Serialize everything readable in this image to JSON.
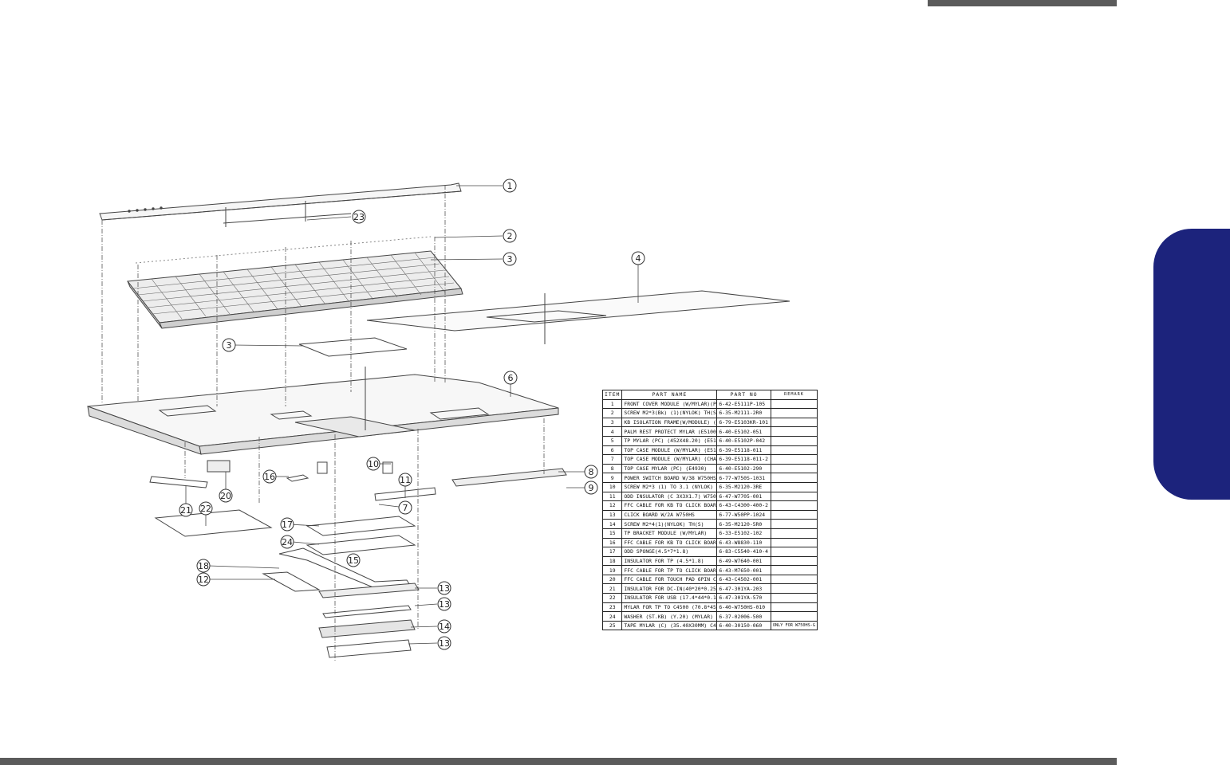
{
  "header": {
    "bar_color": "#5b5b5b"
  },
  "side_tab": {
    "color": "#1c237c"
  },
  "callouts": [
    "1",
    "23",
    "2",
    "3",
    "4",
    "3",
    "6",
    "16",
    "10",
    "8",
    "9",
    "11",
    "7",
    "21",
    "22",
    "20",
    "17",
    "24",
    "15",
    "18",
    "12",
    "13",
    "13",
    "14",
    "13"
  ],
  "parts_table": {
    "headers": {
      "item": "ITEM",
      "name": "PART    NAME",
      "no": "PART    NO",
      "remark": "REMARK"
    },
    "rows": [
      {
        "item": "1",
        "name": "FRONT COVER MODULE (W/MYLAR)(PW) (E4930)",
        "no": "6-42-E5111P-105",
        "remark": ""
      },
      {
        "item": "2",
        "name": "SCREW M2*3(Bk) (1)(NYLOK) TH(S)",
        "no": "6-35-M2111-2R0",
        "remark": ""
      },
      {
        "item": "3",
        "name": "KB ISOLATION FRAME(W/MODULE) (E5100)",
        "no": "6-79-E5103KR-101",
        "remark": ""
      },
      {
        "item": "4",
        "name": "PALM REST PROTECT MYLAR (E5100)",
        "no": "6-40-E5102-051",
        "remark": ""
      },
      {
        "item": "5",
        "name": "TP MYLAR (PC) (452X48.20) (E5100)",
        "no": "6-40-E5102P-042",
        "remark": ""
      },
      {
        "item": "6",
        "name": "TOP CASE MODULE (W/MYLAR) (E5100)",
        "no": "6-39-E5118-011",
        "remark": ""
      },
      {
        "item": "7",
        "name": "TOP CASE MODULE (W/MYLAR) (CHAR) (E5100)",
        "no": "6-39-E5118-011-2",
        "remark": ""
      },
      {
        "item": "8",
        "name": "TOP CASE MYLAR (PC) (E4930)",
        "no": "6-40-E5102-290",
        "remark": ""
      },
      {
        "item": "9",
        "name": "POWER SWITCH BOARD W/38 W750HS",
        "no": "6-77-W750S-1031",
        "remark": ""
      },
      {
        "item": "10",
        "name": "SCREW M2*3 (1) TO 3.1 (NYLOK)",
        "no": "6-35-M2120-3RE",
        "remark": ""
      },
      {
        "item": "11",
        "name": "ODD INSULATOR (C 3X3X1.7) W750SU",
        "no": "6-47-W7705-001",
        "remark": ""
      },
      {
        "item": "12",
        "name": "FFC CABLE FOR KB TO CLICK BOARD W750SU",
        "no": "6-43-C4300-400-2",
        "remark": ""
      },
      {
        "item": "13",
        "name": "CLICK BOARD W/2A W750HS",
        "no": "6-77-W50PP-1024",
        "remark": ""
      },
      {
        "item": "14",
        "name": "SCREW M2*4(1)(NYLOK) TH(S)",
        "no": "6-35-M2120-5R0",
        "remark": ""
      },
      {
        "item": "15",
        "name": "TP BRACKET MODULE (W/MYLAR)",
        "no": "6-33-E5102-102",
        "remark": ""
      },
      {
        "item": "16",
        "name": "FFC CABLE FOR KB TO CLICK BOARD W750SU",
        "no": "6-43-W8830-110",
        "remark": ""
      },
      {
        "item": "17",
        "name": "ODD SPONGE(4.5*7*1.8)",
        "no": "6-83-C5540-410-4",
        "remark": ""
      },
      {
        "item": "18",
        "name": "INSULATOR FOR TP (4.5*1.8)",
        "no": "6-49-W7640-001",
        "remark": ""
      },
      {
        "item": "19",
        "name": "FFC CABLE FOR TP TO CLICK BOARD FOR W750SU",
        "no": "6-43-M7650-001",
        "remark": ""
      },
      {
        "item": "20",
        "name": "FFC CABLE FOR TOUCH PAD 6PIN C4500",
        "no": "6-43-C4502-001",
        "remark": ""
      },
      {
        "item": "21",
        "name": "INSULATOR FOR DC-IN(40*20*0.25)",
        "no": "6-47-301YA-203",
        "remark": ""
      },
      {
        "item": "22",
        "name": "INSULATOR FOR USB (17.4*44*0.175)",
        "no": "6-47-301YA-570",
        "remark": ""
      },
      {
        "item": "23",
        "name": "MYLAR FOR TP TO C4500 (70.8*45)",
        "no": "6-40-W750HS-010",
        "remark": ""
      },
      {
        "item": "24",
        "name": "WASHER (ST.KB) (Y.20) (MYLAR)",
        "no": "6-37-02006-500",
        "remark": ""
      },
      {
        "item": "25",
        "name": "TAPE MYLAR (C) (35.40X30MM) C4500",
        "no": "6-40-30150-060",
        "remark": "ONLY FOR W750HS-G"
      }
    ]
  }
}
